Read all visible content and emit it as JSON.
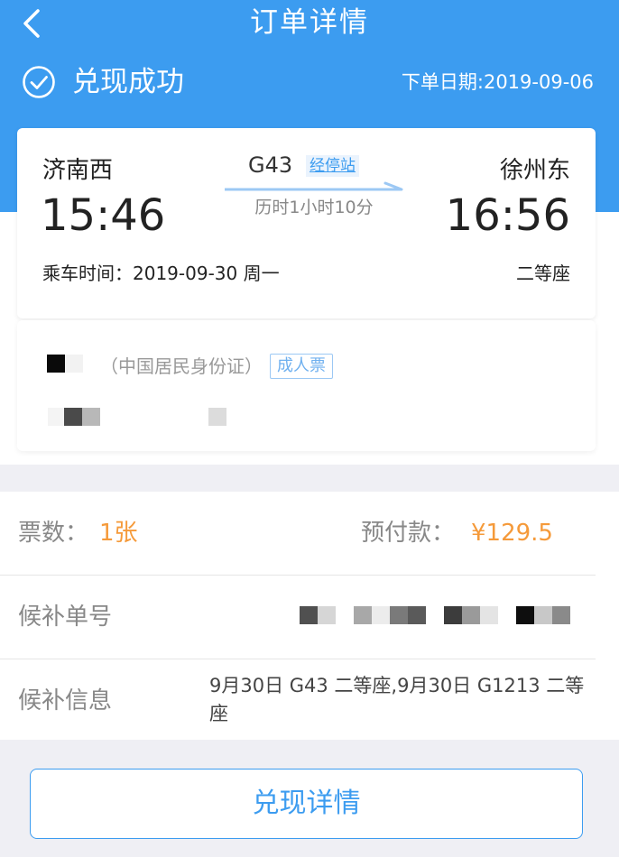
{
  "nav": {
    "title": "订单详情",
    "back_icon": "chevron-left-icon"
  },
  "status": {
    "text": "兑现成功",
    "icon": "check-circle-icon",
    "order_date_label": "下单日期:",
    "order_date": "2019-09-06"
  },
  "trip": {
    "from_station": "济南西",
    "from_time": "15:46",
    "to_station": "徐州东",
    "to_time": "16:56",
    "train_no": "G43",
    "stops_link": "经停站",
    "duration": "历时1小时10分",
    "ride_time": "乘车时间：2019-09-30 周一",
    "seat_class": "二等座"
  },
  "passenger": {
    "id_type": "（中国居民身份证）",
    "ticket_type": "成人票"
  },
  "details": {
    "ticket_count_label": "票数：",
    "ticket_count": "1张",
    "prepay_label": "预付款：",
    "prepay_amount": "¥129.5",
    "waitlist_no_label": "候补单号",
    "waitlist_info_label": "候补信息",
    "waitlist_info": "9月30日 G43 二等座,9月30日 G1213 二等座"
  },
  "actions": {
    "redeem_details": "兑现详情"
  },
  "colors": {
    "brand_blue": "#3c9cf0",
    "price_orange": "#f59a3a"
  }
}
